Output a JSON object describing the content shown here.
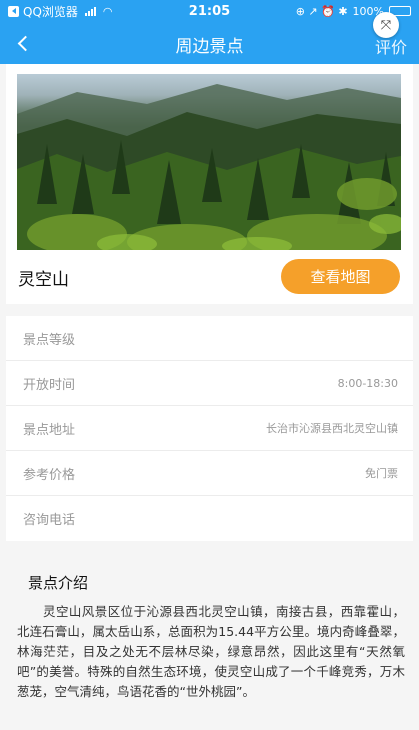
{
  "status_bar": {
    "app": "QQ浏览器",
    "time": "21:05",
    "indicators": "⊕ ↗ ⏰ ✱",
    "battery": "100%",
    "battery_level": 1.0
  },
  "nav": {
    "title": "周边景点",
    "action": "评价",
    "expand_icon": "⤧"
  },
  "spot": {
    "name": "灵空山",
    "map_button": "查看地图"
  },
  "info": [
    {
      "label": "景点等级",
      "value": ""
    },
    {
      "label": "开放时间",
      "value": "8:00-18:30"
    },
    {
      "label": "景点地址",
      "value": "长治市沁源县西北灵空山镇"
    },
    {
      "label": "参考价格",
      "value": "免门票"
    },
    {
      "label": "咨询电话",
      "value": ""
    }
  ],
  "intro": {
    "title": "景点介绍",
    "text": "灵空山风景区位于沁源县西北灵空山镇，南接古县，西靠霍山，北连石膏山，属太岳山系，总面积为15.44平方公里。境内奇峰叠翠，林海茫茫，目及之处无不层林尽染，绿意昂然，因此这里有“天然氧吧”的美誉。特殊的自然生态环境，使灵空山成了一个千峰竞秀，万木葱茏，空气清纯，鸟语花香的“世外桃园”。"
  },
  "colors": {
    "nav_blue": "#2aa2f2",
    "accent_orange": "#f5a02a"
  }
}
